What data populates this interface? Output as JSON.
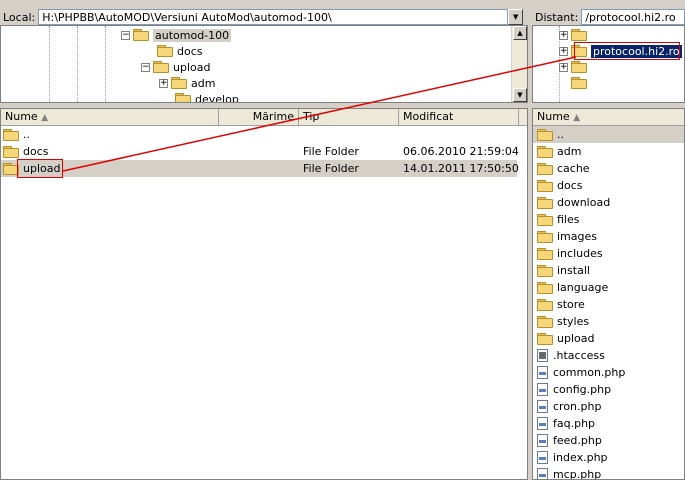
{
  "local": {
    "label": "Local:",
    "path": "H:\\PHPBB\\AutoMOD\\Versiuni AutoMod\\automod-100\\",
    "tree": [
      "automod-100",
      "docs",
      "upload",
      "adm",
      "develop"
    ],
    "columns": {
      "name": "Nume",
      "size": "Mărime",
      "type": "Tip",
      "modified": "Modificat"
    },
    "rows": [
      {
        "name": "..",
        "type": "",
        "modified": ""
      },
      {
        "name": "docs",
        "type": "File Folder",
        "modified": "06.06.2010 21:59:04"
      },
      {
        "name": "upload",
        "type": "File Folder",
        "modified": "14.01.2011 17:50:50"
      }
    ]
  },
  "remote": {
    "label": "Distant:",
    "path": "/protocool.hi2.ro",
    "tree_selected": "protocool.hi2.ro",
    "columns": {
      "name": "Nume"
    },
    "folders": [
      "..",
      "adm",
      "cache",
      "docs",
      "download",
      "files",
      "images",
      "includes",
      "install",
      "language",
      "store",
      "styles",
      "upload"
    ],
    "files": [
      ".htaccess",
      "common.php",
      "config.php",
      "cron.php",
      "faq.php",
      "feed.php",
      "index.php",
      "mcp.php"
    ]
  },
  "colors": {
    "highlight": "#0a246a",
    "annotation": "#e00000",
    "folder": "#f5d77a"
  }
}
